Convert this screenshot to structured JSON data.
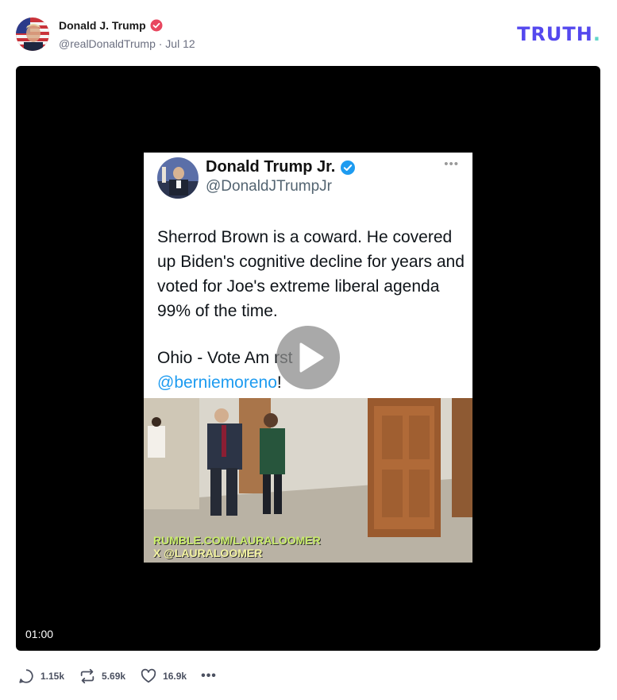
{
  "post": {
    "author_name": "Donald J. Trump",
    "handle": "@realDonaldTrump",
    "date": "Jul 12",
    "meta_line": "@realDonaldTrump · Jul 12"
  },
  "brand": {
    "logo_text": "TRUTH",
    "logo_dot": ".",
    "colors": {
      "logo": "#5448ee",
      "logo_dot": "#61d5c8",
      "verified": "#e8475f"
    }
  },
  "video": {
    "duration": "01:00",
    "tweet": {
      "name": "Donald Trump Jr.",
      "handle": "@DonaldJTrumpJr",
      "body": "Sherrod Brown is a coward. He covered up Biden's cognitive decline for years and voted for Joe's extreme liberal agenda 99% of the time.",
      "line2": "Ohio - Vote Am         rst",
      "mention": "@berniemoreno",
      "mention_tail": "!"
    },
    "watermark_1": "RUMBLE.COM/LAURALOOMER",
    "watermark_2": "X @LAURALOOMER"
  },
  "actions": {
    "replies": "1.15k",
    "reposts": "5.69k",
    "likes": "16.9k",
    "more": "•••"
  }
}
